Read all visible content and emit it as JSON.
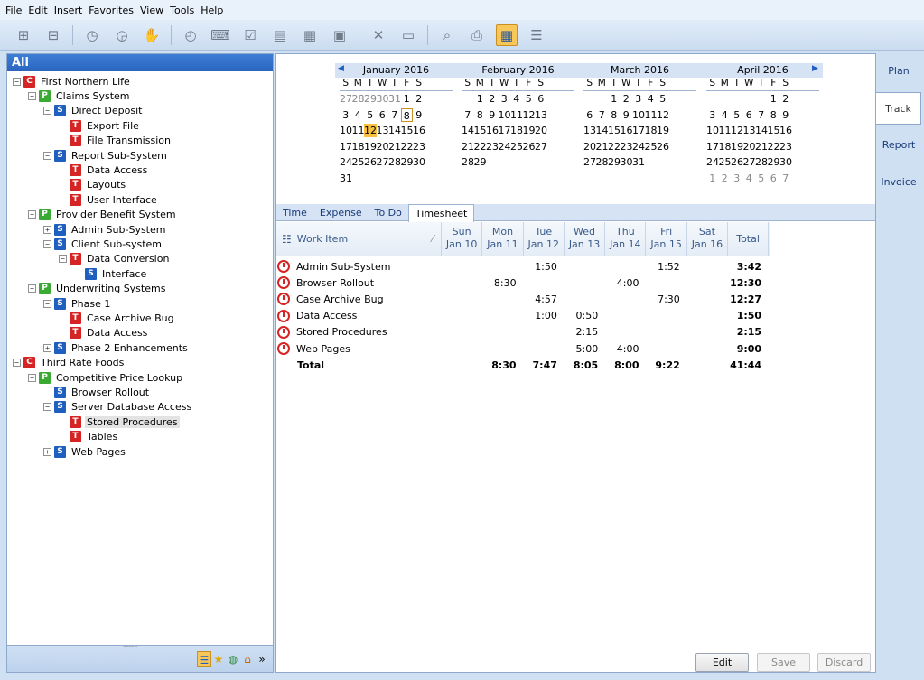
{
  "menu": [
    "File",
    "Edit",
    "Insert",
    "Favorites",
    "View",
    "Tools",
    "Help"
  ],
  "toolbar_icons": [
    "new-project-icon",
    "new-task-icon",
    "clock-icon",
    "clock-stop-icon",
    "hand-icon",
    "timer-icon",
    "keyboard-icon",
    "checklist-icon",
    "document-icon",
    "table-icon",
    "card-icon",
    "delete-icon",
    "window-icon",
    "find-icon",
    "print-icon",
    "calendar-icon",
    "hierarchy-icon"
  ],
  "left": {
    "header": "All",
    "tree": [
      {
        "level": 0,
        "toggle": "−",
        "icon": "C",
        "label": "First Northern Life"
      },
      {
        "level": 1,
        "toggle": "−",
        "icon": "P",
        "label": "Claims System"
      },
      {
        "level": 2,
        "toggle": "−",
        "icon": "S",
        "label": "Direct Deposit"
      },
      {
        "level": 3,
        "toggle": "",
        "icon": "T",
        "label": "Export File"
      },
      {
        "level": 3,
        "toggle": "",
        "icon": "T",
        "label": "File Transmission"
      },
      {
        "level": 2,
        "toggle": "−",
        "icon": "S",
        "label": "Report Sub-System"
      },
      {
        "level": 3,
        "toggle": "",
        "icon": "T",
        "label": "Data Access"
      },
      {
        "level": 3,
        "toggle": "",
        "icon": "T",
        "label": "Layouts"
      },
      {
        "level": 3,
        "toggle": "",
        "icon": "T",
        "label": "User Interface"
      },
      {
        "level": 1,
        "toggle": "−",
        "icon": "P",
        "label": "Provider Benefit System"
      },
      {
        "level": 2,
        "toggle": "+",
        "icon": "S",
        "label": "Admin Sub-System"
      },
      {
        "level": 2,
        "toggle": "−",
        "icon": "S",
        "label": "Client Sub-system"
      },
      {
        "level": 3,
        "toggle": "−",
        "icon": "T",
        "label": "Data Conversion"
      },
      {
        "level": 4,
        "toggle": "",
        "icon": "S",
        "label": "Interface"
      },
      {
        "level": 1,
        "toggle": "−",
        "icon": "P",
        "label": "Underwriting Systems"
      },
      {
        "level": 2,
        "toggle": "−",
        "icon": "S",
        "label": "Phase 1"
      },
      {
        "level": 3,
        "toggle": "",
        "icon": "T",
        "label": "Case Archive Bug"
      },
      {
        "level": 3,
        "toggle": "",
        "icon": "T",
        "label": "Data Access"
      },
      {
        "level": 2,
        "toggle": "+",
        "icon": "S",
        "label": "Phase 2 Enhancements"
      },
      {
        "level": 0,
        "toggle": "−",
        "icon": "C",
        "label": "Third Rate Foods"
      },
      {
        "level": 1,
        "toggle": "−",
        "icon": "P",
        "label": "Competitive Price Lookup"
      },
      {
        "level": 2,
        "toggle": "",
        "icon": "S",
        "label": "Browser Rollout"
      },
      {
        "level": 2,
        "toggle": "−",
        "icon": "S",
        "label": "Server Database Access"
      },
      {
        "level": 3,
        "toggle": "",
        "icon": "T",
        "label": "Stored Procedures",
        "selected": true
      },
      {
        "level": 3,
        "toggle": "",
        "icon": "T",
        "label": "Tables"
      },
      {
        "level": 2,
        "toggle": "+",
        "icon": "S",
        "label": "Web Pages"
      }
    ],
    "footer_icons": [
      "tree-view-icon",
      "favorites-star-icon",
      "globe-icon",
      "home-icon",
      "more-chevron-icon"
    ]
  },
  "calendar": {
    "dow": [
      "S",
      "M",
      "T",
      "W",
      "T",
      "F",
      "S"
    ],
    "months": [
      {
        "title": "January 2016",
        "weeks": [
          [
            "27",
            "28",
            "29",
            "30",
            "31",
            "1",
            "2"
          ],
          [
            "3",
            "4",
            "5",
            "6",
            "7",
            "8",
            "9"
          ],
          [
            "10",
            "11",
            "12",
            "13",
            "14",
            "15",
            "16"
          ],
          [
            "17",
            "18",
            "19",
            "20",
            "21",
            "22",
            "23"
          ],
          [
            "24",
            "25",
            "26",
            "27",
            "28",
            "29",
            "30"
          ],
          [
            "31",
            "",
            "",
            "",
            "",
            "",
            ""
          ]
        ],
        "other": [
          [
            0,
            1,
            2,
            3,
            4
          ]
        ],
        "today": "12",
        "selected": "8"
      },
      {
        "title": "February 2016",
        "weeks": [
          [
            "",
            "1",
            "2",
            "3",
            "4",
            "5",
            "6"
          ],
          [
            "7",
            "8",
            "9",
            "10",
            "11",
            "12",
            "13"
          ],
          [
            "14",
            "15",
            "16",
            "17",
            "18",
            "19",
            "20"
          ],
          [
            "21",
            "22",
            "23",
            "24",
            "25",
            "26",
            "27"
          ],
          [
            "28",
            "29",
            "",
            "",
            "",
            "",
            ""
          ]
        ]
      },
      {
        "title": "March 2016",
        "weeks": [
          [
            "",
            "",
            "1",
            "2",
            "3",
            "4",
            "5"
          ],
          [
            "6",
            "7",
            "8",
            "9",
            "10",
            "11",
            "12"
          ],
          [
            "13",
            "14",
            "15",
            "16",
            "17",
            "18",
            "19"
          ],
          [
            "20",
            "21",
            "22",
            "23",
            "24",
            "25",
            "26"
          ],
          [
            "27",
            "28",
            "29",
            "30",
            "31",
            "",
            ""
          ]
        ]
      },
      {
        "title": "April 2016",
        "weeks": [
          [
            "",
            "",
            "",
            "",
            "",
            "1",
            "2"
          ],
          [
            "3",
            "4",
            "5",
            "6",
            "7",
            "8",
            "9"
          ],
          [
            "10",
            "11",
            "12",
            "13",
            "14",
            "15",
            "16"
          ],
          [
            "17",
            "18",
            "19",
            "20",
            "21",
            "22",
            "23"
          ],
          [
            "24",
            "25",
            "26",
            "27",
            "28",
            "29",
            "30"
          ],
          [
            "1",
            "2",
            "3",
            "4",
            "5",
            "6",
            "7"
          ]
        ],
        "otherLastRow": true
      }
    ]
  },
  "tabs": [
    "Time",
    "Expense",
    "To Do",
    "Timesheet"
  ],
  "active_tab": "Timesheet",
  "timesheet": {
    "work_item_header": "Work Item",
    "days": [
      {
        "day": "Sun",
        "date": "Jan 10"
      },
      {
        "day": "Mon",
        "date": "Jan 11"
      },
      {
        "day": "Tue",
        "date": "Jan 12"
      },
      {
        "day": "Wed",
        "date": "Jan 13"
      },
      {
        "day": "Thu",
        "date": "Jan 14"
      },
      {
        "day": "Fri",
        "date": "Jan 15"
      },
      {
        "day": "Sat",
        "date": "Jan 16"
      }
    ],
    "total_header": "Total",
    "rows": [
      {
        "item": "Admin Sub-System",
        "values": [
          "",
          "",
          "1:50",
          "",
          "",
          "1:52",
          ""
        ],
        "total": "3:42"
      },
      {
        "item": "Browser Rollout",
        "values": [
          "",
          "8:30",
          "",
          "",
          "4:00",
          "",
          ""
        ],
        "total": "12:30"
      },
      {
        "item": "Case Archive Bug",
        "values": [
          "",
          "",
          "4:57",
          "",
          "",
          "7:30",
          ""
        ],
        "total": "12:27"
      },
      {
        "item": "Data Access",
        "values": [
          "",
          "",
          "1:00",
          "0:50",
          "",
          "",
          ""
        ],
        "total": "1:50"
      },
      {
        "item": "Stored Procedures",
        "values": [
          "",
          "",
          "",
          "2:15",
          "",
          "",
          ""
        ],
        "total": "2:15"
      },
      {
        "item": "Web Pages",
        "values": [
          "",
          "",
          "",
          "5:00",
          "4:00",
          "",
          ""
        ],
        "total": "9:00"
      }
    ],
    "total_row": {
      "item": "Total",
      "values": [
        "",
        "8:30",
        "7:47",
        "8:05",
        "8:00",
        "9:22",
        ""
      ],
      "total": "41:44"
    }
  },
  "buttons": {
    "edit": "Edit",
    "save": "Save",
    "discard": "Discard"
  },
  "right_tabs": [
    "Plan",
    "Track",
    "Report",
    "Invoice"
  ],
  "active_right_tab": "Track"
}
